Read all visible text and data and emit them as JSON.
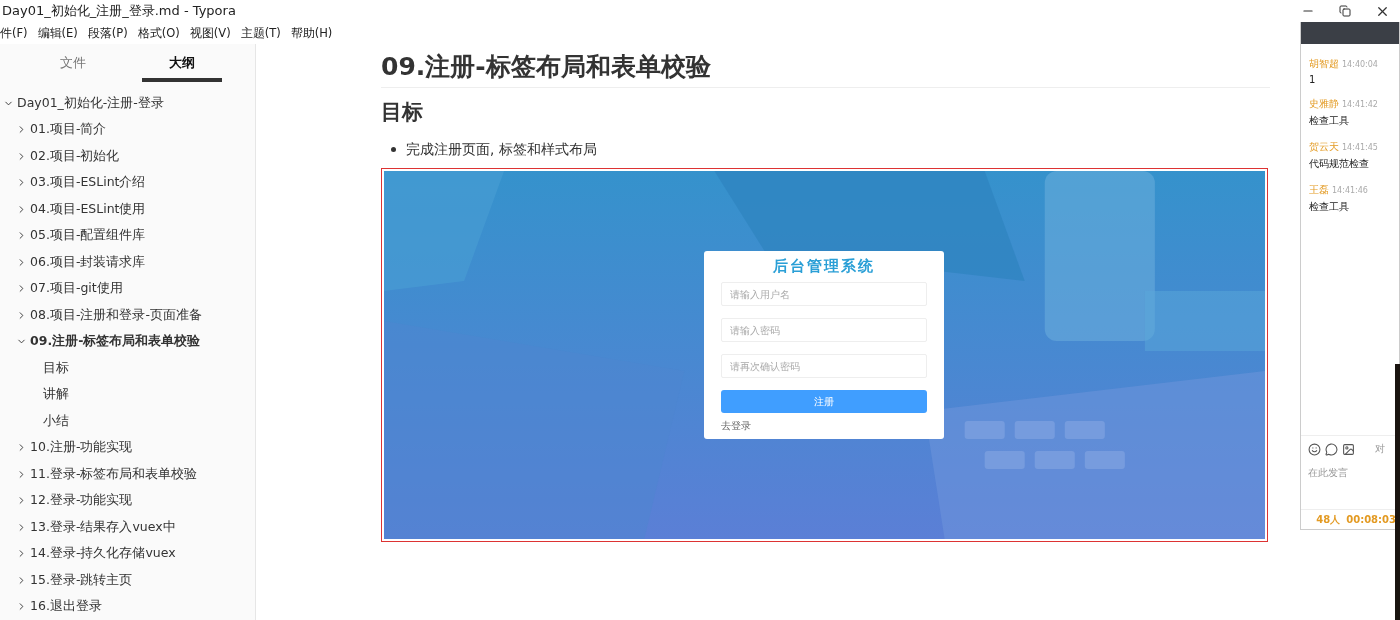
{
  "window": {
    "title": "Day01_初始化_注册_登录.md - Typora"
  },
  "menu": [
    "件(F)",
    "编辑(E)",
    "段落(P)",
    "格式(O)",
    "视图(V)",
    "主题(T)",
    "帮助(H)"
  ],
  "sidebar": {
    "tabs": [
      {
        "label": "文件",
        "selected": false
      },
      {
        "label": "大纲",
        "selected": true
      }
    ],
    "outline": [
      {
        "label": "Day01_初始化-注册-登录",
        "expanded": true,
        "children": [
          {
            "label": "01.项目-简介",
            "expanded": false
          },
          {
            "label": "02.项目-初始化",
            "expanded": false
          },
          {
            "label": "03.项目-ESLint介绍",
            "expanded": false
          },
          {
            "label": "04.项目-ESLint使用",
            "expanded": false
          },
          {
            "label": "05.项目-配置组件库",
            "expanded": false
          },
          {
            "label": "06.项目-封装请求库",
            "expanded": false
          },
          {
            "label": "07.项目-git使用",
            "expanded": false
          },
          {
            "label": "08.项目-注册和登录-页面准备",
            "expanded": false
          },
          {
            "label": "09.注册-标签布局和表单校验",
            "expanded": true,
            "selected": true,
            "children": [
              {
                "label": "目标"
              },
              {
                "label": "讲解"
              },
              {
                "label": "小结"
              }
            ]
          },
          {
            "label": "10.注册-功能实现",
            "expanded": false
          },
          {
            "label": "11.登录-标签布局和表单校验",
            "expanded": false
          },
          {
            "label": "12.登录-功能实现",
            "expanded": false
          },
          {
            "label": "13.登录-结果存入vuex中",
            "expanded": false
          },
          {
            "label": "14.登录-持久化存储vuex",
            "expanded": false
          },
          {
            "label": "15.登录-跳转主页",
            "expanded": false
          },
          {
            "label": "16.退出登录",
            "expanded": false
          }
        ]
      }
    ]
  },
  "document": {
    "heading": "09.注册-标签布局和表单校验",
    "subheading": "目标",
    "bullets": [
      "完成注册页面, 标签和样式布局"
    ],
    "screenshot": {
      "kind": "picture",
      "form": {
        "title": "后台管理系统",
        "fields": [
          {
            "placeholder": "请输入用户名"
          },
          {
            "placeholder": "请输入密码"
          },
          {
            "placeholder": "请再次确认密码"
          }
        ],
        "button": "注册",
        "link": "去登录"
      }
    }
  },
  "chat": {
    "messages": [
      {
        "name": "胡智超",
        "time": "14:40:04",
        "text": "1"
      },
      {
        "name": "史雅静",
        "time": "14:41:42",
        "text": "检查工具"
      },
      {
        "name": "贺云天",
        "time": "14:41:45",
        "text": "代码规范检查"
      },
      {
        "name": "王磊",
        "time": "14:41:46",
        "text": "检查工具"
      }
    ],
    "side_label": "对",
    "placeholder": "在此发言",
    "count": "48人",
    "duration": "00:08:03"
  }
}
